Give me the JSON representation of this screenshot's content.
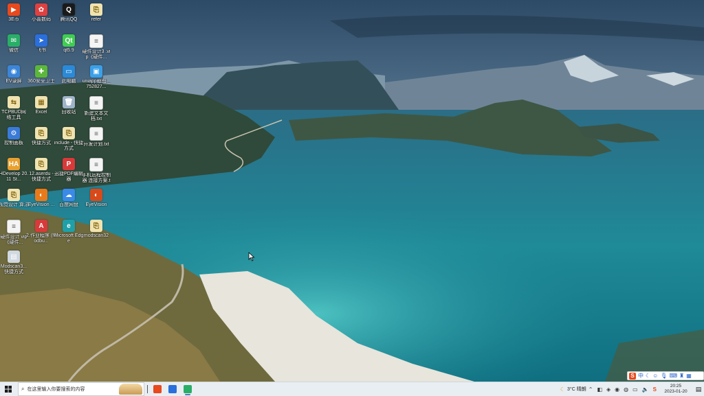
{
  "desktop": {
    "icons": [
      {
        "label": "3E币",
        "color": "#e8491d",
        "ch": "▶"
      },
      {
        "label": "小喜数码",
        "color": "#e04040",
        "ch": "✿"
      },
      {
        "label": "腾讯QQ",
        "color": "#1a1a1a",
        "ch": "Q"
      },
      {
        "label": "refer",
        "color": "#f0e3b0",
        "ch": "⎘",
        "kind": "lnk"
      },
      {
        "label": "微信",
        "color": "#2aae67",
        "ch": "✉"
      },
      {
        "label": "飞书",
        "color": "#2a6fdb",
        "ch": "➤"
      },
      {
        "label": "qt5.9",
        "color": "#41cd52",
        "ch": "Qt"
      },
      {
        "label": "硬件设计3 .vip《硬件...",
        "color": "#ffffff",
        "ch": "≡",
        "kind": "doc"
      },
      {
        "label": "EV录屏",
        "color": "#3b86d8",
        "ch": "◉"
      },
      {
        "label": "360安全卫士",
        "color": "#5bb83a",
        "ch": "✚"
      },
      {
        "label": "此电脑",
        "color": "#2a8ad8",
        "ch": "▭"
      },
      {
        "label": "uniapp截图 _752827...",
        "color": "#3aa0e8",
        "ch": "▣"
      },
      {
        "label": "TCPBUD网 络工具",
        "color": "#f0e3b0",
        "ch": "⇆",
        "kind": "lnk"
      },
      {
        "label": "Excel",
        "color": "#f0e3b0",
        "ch": "▦",
        "kind": "lnk"
      },
      {
        "label": "回收站",
        "color": "#9fb3c8",
        "ch": "🗑"
      },
      {
        "label": "新建文本文 档.txt",
        "color": "#ffffff",
        "ch": "≡",
        "kind": "doc"
      },
      {
        "label": "控制面板",
        "color": "#3a7ad8",
        "ch": "⚙"
      },
      {
        "label": "快捷方式",
        "color": "#f0e3b0",
        "ch": "⎘",
        "kind": "lnk"
      },
      {
        "label": "include - 快捷方式",
        "color": "#f0e3b0",
        "ch": "⎘",
        "kind": "lnk"
      },
      {
        "label": "开发计划.txt",
        "color": "#ffffff",
        "ch": "≡",
        "kind": "doc"
      },
      {
        "label": "HDevelop 20.11 St...",
        "color": "#e8a030",
        "ch": "HA"
      },
      {
        "label": "12.aserdu - 快捷方式",
        "color": "#f0e3b0",
        "ch": "⎘",
        "kind": "lnk"
      },
      {
        "label": "迅捷PDF编辑 器",
        "color": "#d83a3a",
        "ch": "P"
      },
      {
        "label": "手机远程控制器 连接方案.txt",
        "color": "#ffffff",
        "ch": "≡",
        "kind": "doc"
      },
      {
        "label": "视觉设计 算法",
        "color": "#f0e3b0",
        "ch": "⎘",
        "kind": "lnk"
      },
      {
        "label": "EyeVision ...",
        "color": "#e87a1a",
        "ch": "◐"
      },
      {
        "label": "百度网盘",
        "color": "#3a8ae8",
        "ch": "☁"
      },
      {
        "label": "EyeVision",
        "color": "#d84a1a",
        "ch": "◐"
      },
      {
        "label": "硬件设计 vip《硬件...",
        "color": "#ffffff",
        "ch": "≡",
        "kind": "doc"
      },
      {
        "label": "2.作业程序 (Modbu...",
        "color": "#d83a3a",
        "ch": "A"
      },
      {
        "label": "Microsoft Edge",
        "color": "#1fa0a8",
        "ch": "e"
      },
      {
        "label": "modscan32",
        "color": "#f0e3b0",
        "ch": "⎘",
        "kind": "lnk"
      },
      {
        "label": "Modscan3... 快捷方式",
        "color": "#d0d8e0",
        "ch": "▤"
      }
    ]
  },
  "taskbar": {
    "search_placeholder": "在这里输入你要搜索的内容",
    "apps": [
      {
        "name": "app-3e",
        "color": "#e8491d"
      },
      {
        "name": "app-feishu",
        "color": "#2a6fdb"
      },
      {
        "name": "app-wechat",
        "color": "#2aae67"
      }
    ],
    "weather": "3°C 晴朗",
    "time": "20:25",
    "date": "2023-01-20"
  },
  "ime": {
    "label": "中"
  }
}
